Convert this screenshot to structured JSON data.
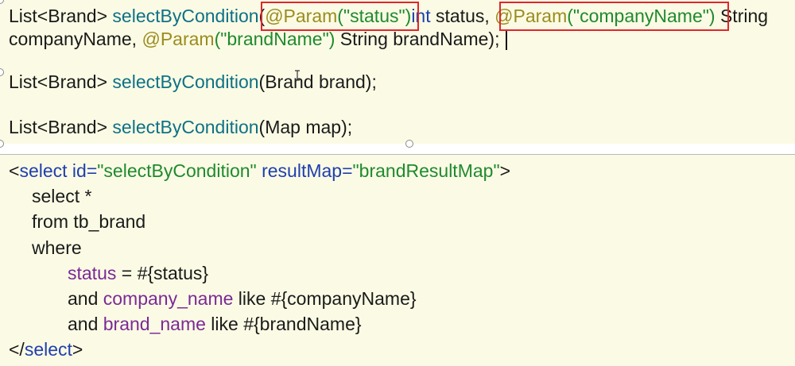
{
  "java": {
    "line1": {
      "a": "List<Brand> ",
      "b": "selectByCondition",
      "c": "(",
      "d": "@Param",
      "e": "(\"status\")",
      "f": "int",
      "g": " status, ",
      "h": "@Param",
      "i": "(\"companyName\")",
      "j": " String"
    },
    "line2": {
      "a": "companyName, ",
      "b": "@Param",
      "c": "(\"brandName\")",
      "d": " String brandName);"
    },
    "line3": {
      "a": "List<Brand> ",
      "b": "selectByCondition",
      "c": "(Brand brand);"
    },
    "line4": {
      "a": "List<Brand> ",
      "b": "selectByCondition",
      "c": "(Map map);"
    }
  },
  "xml": {
    "open": {
      "a": "<",
      "b": "select",
      "c": " id=",
      "d": "\"selectByCondition\"",
      "e": " resultMap=",
      "f": "\"brandResultMap\"",
      "g": ">"
    },
    "select_kw": "select *",
    "from_kw": "from tb_brand",
    "where_kw": "where",
    "cond1": {
      "col": "status",
      "rest": " = #{status}"
    },
    "cond2": {
      "and": "and ",
      "col": "company_name",
      "rest": " like #{companyName}"
    },
    "cond3": {
      "and": "and ",
      "col": "brand_name",
      "rest": " like #{brandName}"
    },
    "close": {
      "a": "</",
      "b": "select",
      "c": ">"
    }
  },
  "colors": {
    "panel_bg": "#fbfbe5",
    "highlight_box": "#e0262a",
    "method": "#0e7185",
    "annotation": "#9b8c1e",
    "string": "#1f8a2e",
    "keyword": "#1f3fae",
    "column": "#7b2a96"
  }
}
